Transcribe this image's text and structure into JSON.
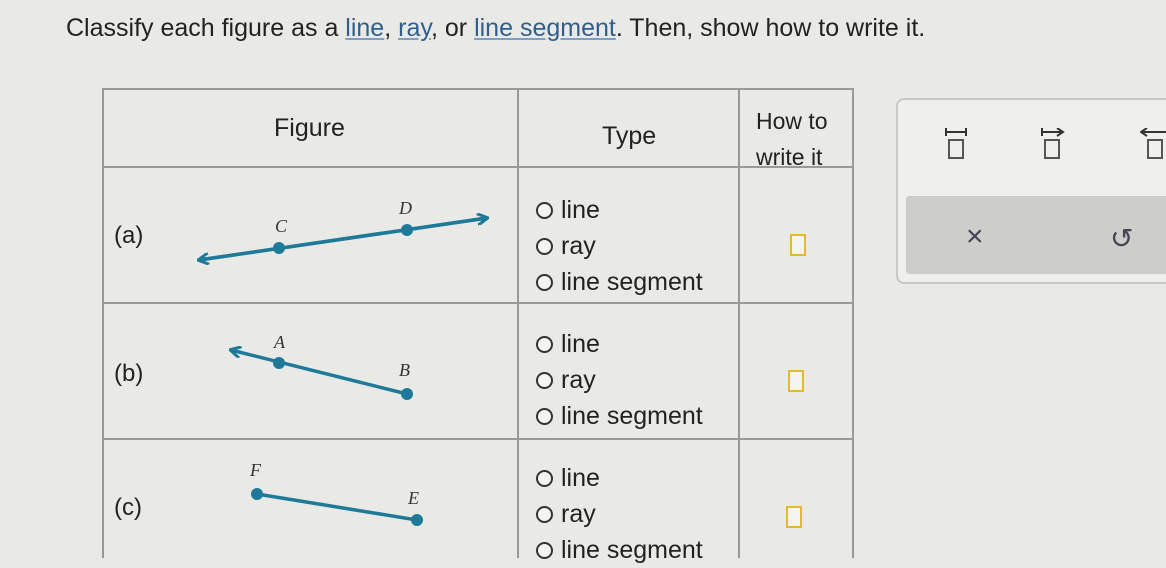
{
  "instructions": {
    "prefix": "Classify each figure as a ",
    "term_line": "line",
    "sep1": ", ",
    "term_ray": "ray",
    "sep2": ", or ",
    "term_segment": "line segment",
    "suffix": ". Then, show how to write it."
  },
  "table": {
    "headers": {
      "figure": "Figure",
      "type": "Type",
      "write_line1": "How to",
      "write_line2": "write it"
    },
    "rows": [
      {
        "label": "(a)",
        "points": [
          "C",
          "D"
        ],
        "options": [
          "line",
          "ray",
          "line segment"
        ]
      },
      {
        "label": "(b)",
        "points": [
          "A",
          "B"
        ],
        "options": [
          "line",
          "ray",
          "line segment"
        ]
      },
      {
        "label": "(c)",
        "points": [
          "F",
          "E"
        ],
        "options": [
          "line",
          "ray",
          "line segment"
        ]
      }
    ]
  },
  "colors": {
    "figure_stroke": "#1f7a9a",
    "answer_box_border": "#e7b92a",
    "link": "#2f5f8f"
  },
  "toolbar": {
    "icons": [
      "segment-notation-icon",
      "ray-notation-icon",
      "line-notation-icon",
      "clear-icon",
      "undo-icon"
    ],
    "clear_symbol": "×",
    "undo_symbol": "↺"
  }
}
